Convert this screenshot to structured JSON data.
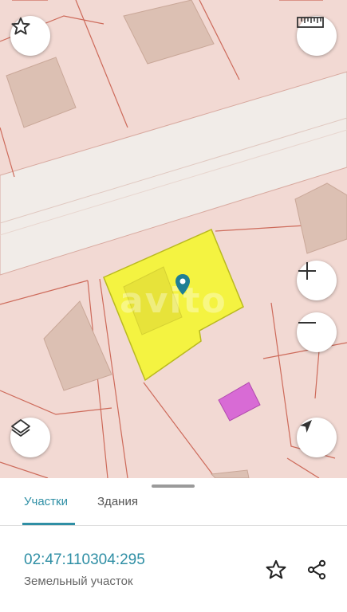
{
  "map": {
    "watermark": "avito",
    "colors": {
      "land": "#f2d9d3",
      "road": "#f1ece8",
      "building": "#dcc0b3",
      "boundary": "#cd6a5a",
      "selected_parcel": "#f4f341",
      "selected_border": "#b9b91f",
      "pin": "#1f7f95",
      "marker": "#d86bd5"
    },
    "controls": {
      "favorite": "star-icon",
      "ruler": "ruler-icon",
      "zoom_in": "plus-icon",
      "zoom_out": "minus-icon",
      "layers": "layers-icon",
      "locate": "navigation-arrow-icon"
    }
  },
  "sheet": {
    "tabs": [
      {
        "label": "Участки",
        "active": true
      },
      {
        "label": "Здания",
        "active": false
      }
    ],
    "cadastral_number": "02:47:110304:295",
    "object_type": "Земельный участок",
    "actions": [
      "star-icon",
      "share-icon"
    ],
    "accent": "#2f8fa5"
  }
}
